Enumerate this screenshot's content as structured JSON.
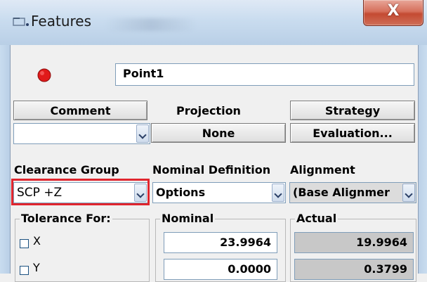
{
  "window": {
    "title": "Features",
    "close_label": "X"
  },
  "feature": {
    "status_color": "#e01a1a",
    "name": "Point1"
  },
  "buttons": {
    "comment": "Comment",
    "strategy": "Strategy",
    "projection_label": "Projection",
    "projection_value": "None",
    "evaluation": "Evaluation..."
  },
  "labels": {
    "clearance_group": "Clearance Group",
    "nominal_definition": "Nominal Definition",
    "alignment": "Alignment"
  },
  "combos": {
    "top_left": "",
    "clearance_group": "SCP +Z",
    "nominal_definition": "Options",
    "alignment": "(Base Alignmer"
  },
  "groups": {
    "tolerance_for": "Tolerance For:",
    "nominal": "Nominal",
    "actual": "Actual"
  },
  "rows": [
    {
      "axis": "X",
      "nominal": "23.9964",
      "actual": "19.9964"
    },
    {
      "axis": "Y",
      "nominal": "0.0000",
      "actual": "0.3799"
    }
  ],
  "colors": {
    "highlight": "#e0262e"
  }
}
